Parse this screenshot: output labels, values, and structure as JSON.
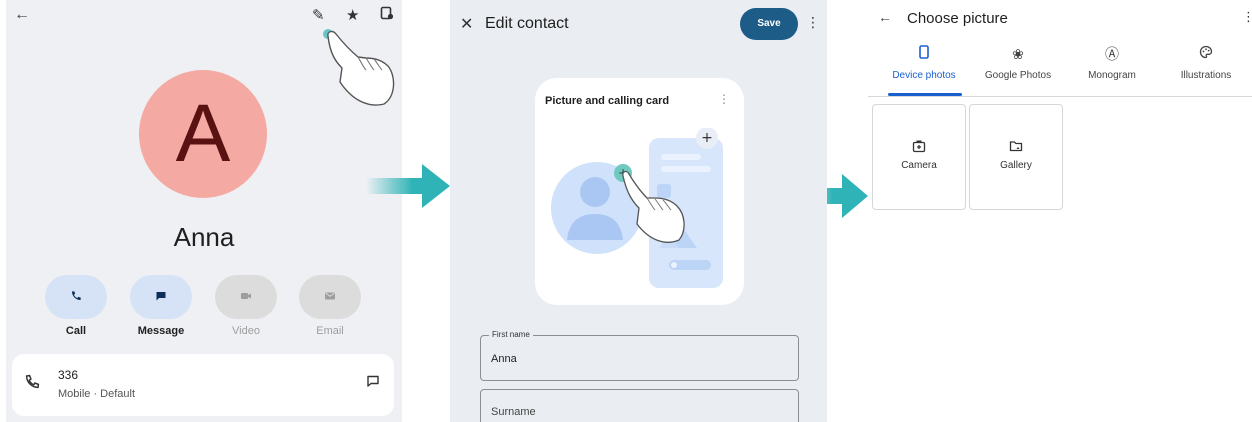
{
  "colors": {
    "accent_blue": "#1a5fd0",
    "save_button": "#1c5c86",
    "avatar_bg": "#f4aaa2",
    "avatar_letter": "#5a1111",
    "arrow_teal": "#2fb3b6",
    "action_active_bg": "#d6e3f6",
    "action_disabled_bg": "#dcdcdc"
  },
  "screen1": {
    "icons": {
      "back": "back-arrow-icon",
      "edit": "pencil-icon",
      "favorite": "star-icon",
      "more": "contact-settings-icon"
    },
    "avatar_letter": "A",
    "contact_name": "Anna",
    "actions": [
      {
        "label": "Call",
        "icon": "phone-icon",
        "enabled": true
      },
      {
        "label": "Message",
        "icon": "message-icon",
        "enabled": true
      },
      {
        "label": "Video",
        "icon": "video-icon",
        "enabled": false
      },
      {
        "label": "Email",
        "icon": "email-icon",
        "enabled": false
      }
    ],
    "phone": {
      "number": "336",
      "type": "Mobile · Default"
    }
  },
  "screen2": {
    "title": "Edit contact",
    "save_label": "Save",
    "card_title": "Picture and calling card",
    "fields": [
      {
        "label": "First name",
        "value": "Anna"
      },
      {
        "label": "",
        "placeholder": "Surname"
      }
    ]
  },
  "screen3": {
    "title": "Choose picture",
    "tabs": [
      {
        "label": "Device photos",
        "icon": "phone-device-icon",
        "active": true
      },
      {
        "label": "Google Photos",
        "icon": "pinwheel-icon",
        "active": false
      },
      {
        "label": "Monogram",
        "icon": "monogram-icon",
        "active": false
      },
      {
        "label": "Illustrations",
        "icon": "palette-icon",
        "active": false
      }
    ],
    "options": [
      {
        "label": "Camera",
        "icon": "camera-icon"
      },
      {
        "label": "Gallery",
        "icon": "gallery-folder-icon"
      }
    ]
  }
}
